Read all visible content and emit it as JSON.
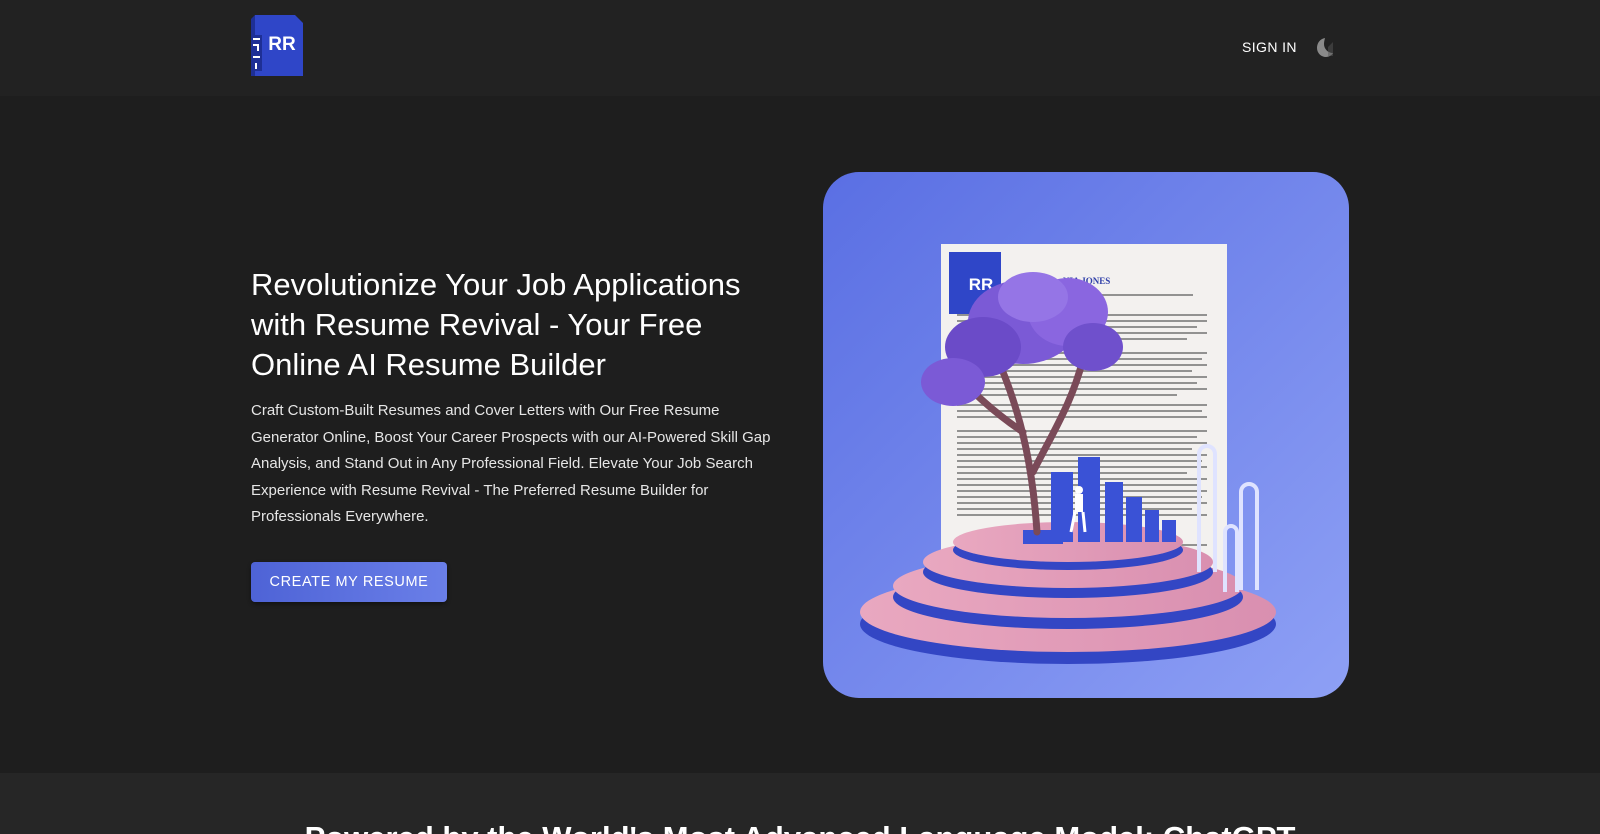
{
  "header": {
    "logo_text": "RR",
    "signin_label": "SIGN IN",
    "theme_icon": "moon-icon"
  },
  "hero": {
    "title": "Revolutionize Your Job Applications with Resume Revival - Your Free Online AI Resume Builder",
    "description": "Craft Custom-Built Resumes and Cover Letters with Our Free Resume Generator Online, Boost Your Career Prospects with our AI-Powered Skill Gap Analysis, and Stand Out in Any Professional Field. Elevate Your Job Search Experience with Resume Revival - The Preferred Resume Builder for Professionals Everywhere.",
    "cta_label": "CREATE MY RESUME",
    "image_resume_name": "NIA JONES",
    "image_logo_text": "RR"
  },
  "section2": {
    "title": "Powered by the World's Most Advanced Language Model: ChatGPT"
  },
  "colors": {
    "background": "#1e1e1e",
    "header": "#222222",
    "accent": "#5a6fe0",
    "logo_blue": "#2f46c8"
  }
}
